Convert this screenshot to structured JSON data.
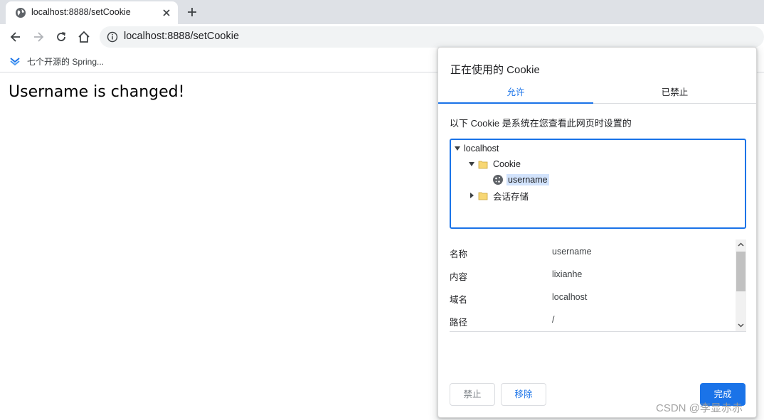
{
  "browser": {
    "tab_title": "localhost:8888/setCookie",
    "url": "localhost:8888/setCookie",
    "bookmarks": [
      {
        "label": "七个开源的 Spring..."
      }
    ]
  },
  "page": {
    "heading": "Username is changed!"
  },
  "cookie_dialog": {
    "title": "正在使用的 Cookie",
    "tabs": [
      {
        "label": "允许",
        "active": true
      },
      {
        "label": "已禁止",
        "active": false
      }
    ],
    "description": "以下 Cookie 是系统在您查看此网页时设置的",
    "tree": {
      "site": "localhost",
      "folder_cookie": "Cookie",
      "cookie_item": "username",
      "folder_storage": "会话存储"
    },
    "details": [
      {
        "key": "名称",
        "value": "username"
      },
      {
        "key": "内容",
        "value": "lixianhe"
      },
      {
        "key": "域名",
        "value": "localhost"
      },
      {
        "key": "路径",
        "value": "/"
      }
    ],
    "buttons": {
      "block": "禁止",
      "remove": "移除",
      "done": "完成"
    }
  },
  "watermark": "CSDN @李显赤赤",
  "colors": {
    "accent": "#1a73e8",
    "selection": "#d2e3fc",
    "tabstrip": "#dee1e6"
  }
}
